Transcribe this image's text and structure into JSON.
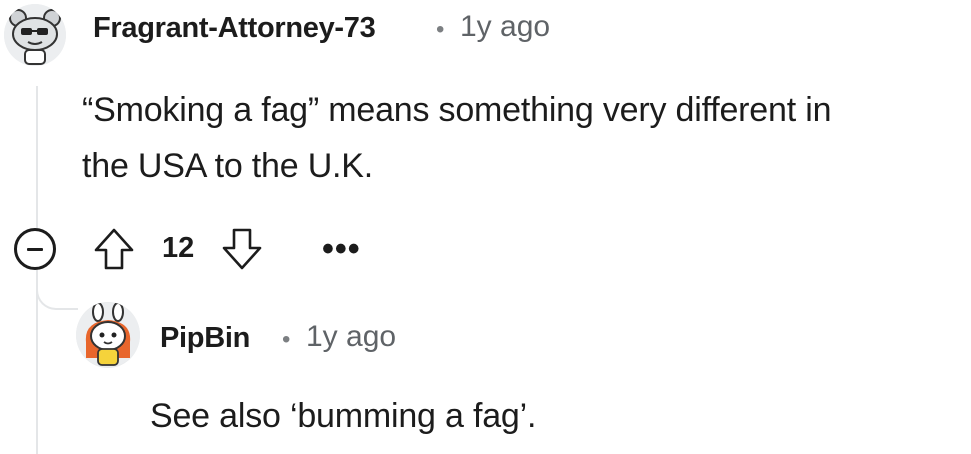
{
  "comment": {
    "author": "Fragrant-Attorney-73",
    "separator": "•",
    "time_ago": "1y ago",
    "body_line1": "“Smoking a fag” means something very different in",
    "body_line2": "the USA to the U.K.",
    "score": "12",
    "more_label": "•••"
  },
  "reply": {
    "author": "PipBin",
    "separator": "•",
    "time_ago": "1y ago",
    "body": "See also ‘bumming a fag’."
  }
}
